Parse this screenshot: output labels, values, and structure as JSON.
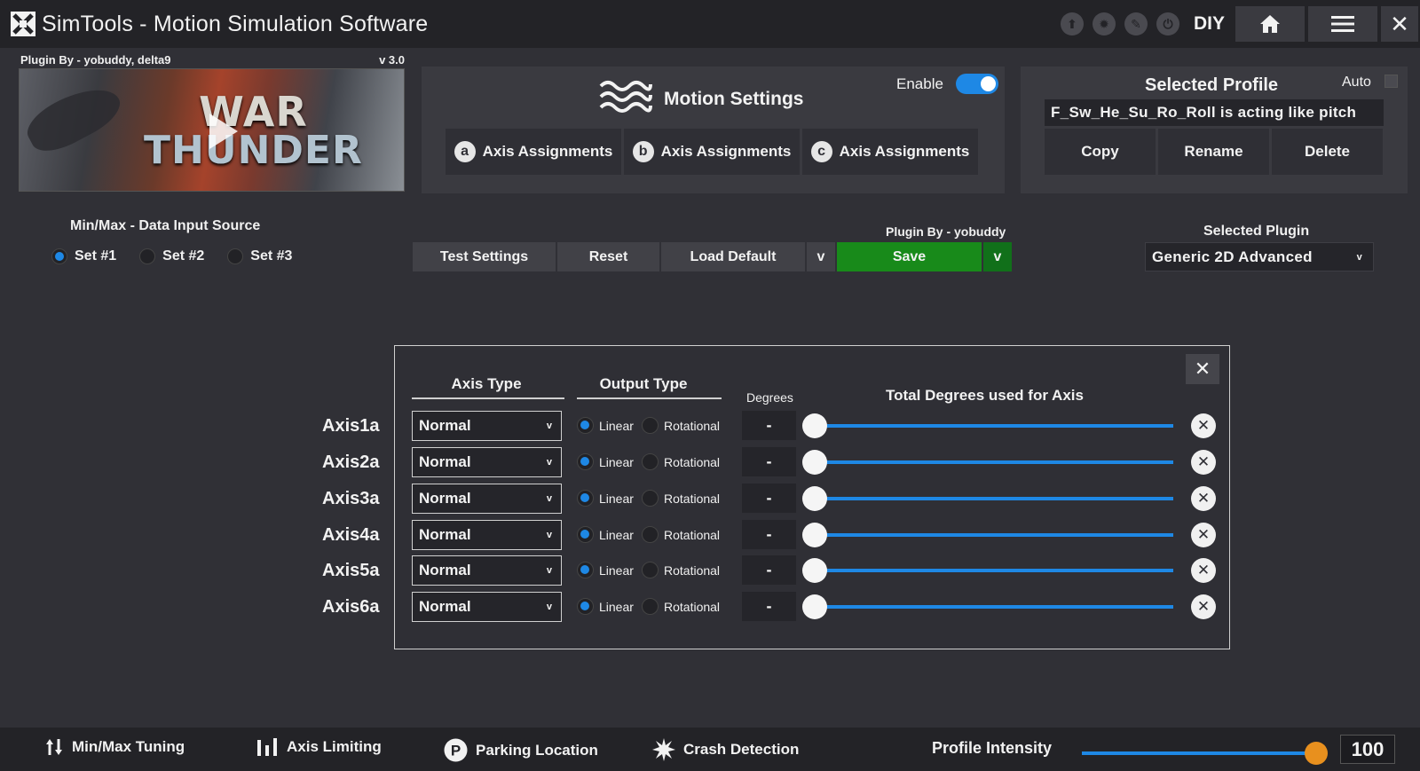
{
  "app": {
    "title": "SimTools - Motion Simulation Software",
    "diy_label": "DIY"
  },
  "plugin_info": {
    "author": "Plugin By - yobuddy, delta9",
    "version": "v 3.0",
    "banner_line1": "WAR",
    "banner_line2": "THUNDER"
  },
  "motion_settings": {
    "title": "Motion Settings",
    "enable_label": "Enable",
    "enabled": true,
    "tabs": [
      {
        "badge": "a",
        "label": "Axis Assignments"
      },
      {
        "badge": "b",
        "label": "Axis Assignments"
      },
      {
        "badge": "c",
        "label": "Axis Assignments"
      }
    ]
  },
  "profile": {
    "title": "Selected Profile",
    "auto_label": "Auto",
    "auto_checked": false,
    "name": "F_Sw_He_Su_Ro_Roll is acting like pitch",
    "buttons": [
      "Copy",
      "Rename",
      "Delete"
    ]
  },
  "data_input": {
    "label": "Min/Max - Data Input Source",
    "sets": [
      {
        "label": "Set #1",
        "selected": true
      },
      {
        "label": "Set #2",
        "selected": false
      },
      {
        "label": "Set #3",
        "selected": false
      }
    ]
  },
  "actions": {
    "plugin_by": "Plugin By - yobuddy",
    "test_settings": "Test Settings",
    "reset": "Reset",
    "load_default": "Load Default",
    "dropdown_v": "v",
    "save": "Save"
  },
  "selected_plugin": {
    "label": "Selected Plugin",
    "value": "Generic 2D Advanced",
    "chevron": "v"
  },
  "axis_dialog": {
    "close_glyph": "✕",
    "col_axis_type": "Axis Type",
    "col_output_type": "Output Type",
    "col_degrees": "Degrees",
    "col_total": "Total Degrees used for Axis",
    "linear_label": "Linear",
    "rotational_label": "Rotational",
    "select_chevron": "v",
    "clear_glyph": "✕",
    "rows": [
      {
        "axis": "Axis1a",
        "type": "Normal",
        "output": "linear",
        "degrees": "-",
        "slider": 0
      },
      {
        "axis": "Axis2a",
        "type": "Normal",
        "output": "linear",
        "degrees": "-",
        "slider": 0
      },
      {
        "axis": "Axis3a",
        "type": "Normal",
        "output": "linear",
        "degrees": "-",
        "slider": 0
      },
      {
        "axis": "Axis4a",
        "type": "Normal",
        "output": "linear",
        "degrees": "-",
        "slider": 0
      },
      {
        "axis": "Axis5a",
        "type": "Normal",
        "output": "linear",
        "degrees": "-",
        "slider": 0
      },
      {
        "axis": "Axis6a",
        "type": "Normal",
        "output": "linear",
        "degrees": "-",
        "slider": 0
      }
    ]
  },
  "bottom_bar": {
    "items": [
      {
        "label": "Min/Max Tuning",
        "icon": "up-down-arrows-icon"
      },
      {
        "label": "Axis Limiting",
        "icon": "bars-icon"
      },
      {
        "label": "Parking Location",
        "icon": "parking-icon"
      },
      {
        "label": "Crash Detection",
        "icon": "crash-burst-icon"
      }
    ],
    "intensity_label": "Profile Intensity",
    "intensity_value": "100",
    "intensity_fraction": 1.0
  },
  "colors": {
    "accent": "#1e88e5",
    "save_green": "#188a1a",
    "intensity_knob": "#e8901e",
    "background": "#303036"
  }
}
